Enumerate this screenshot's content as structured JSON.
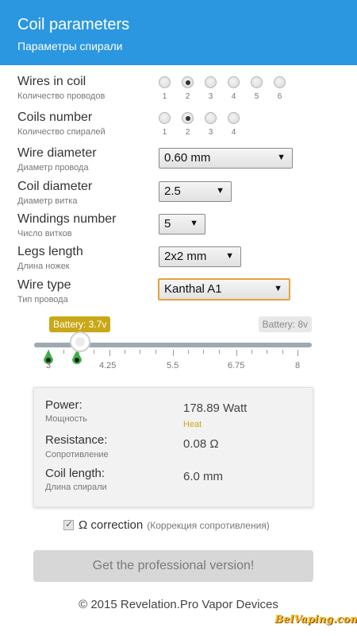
{
  "header": {
    "title": "Coil parameters",
    "subtitle": "Параметры спирали"
  },
  "params": {
    "wires": {
      "label": "Wires in coil",
      "sub": "Количество проводов",
      "options": [
        {
          "num": "1",
          "selected": false
        },
        {
          "num": "2",
          "selected": true
        },
        {
          "num": "3",
          "selected": false
        },
        {
          "num": "4",
          "selected": false
        },
        {
          "num": "5",
          "selected": false
        },
        {
          "num": "6",
          "selected": false
        }
      ]
    },
    "coils": {
      "label": "Coils number",
      "sub": "Количество спиралей",
      "options": [
        {
          "num": "1",
          "selected": false
        },
        {
          "num": "2",
          "selected": true
        },
        {
          "num": "3",
          "selected": false
        },
        {
          "num": "4",
          "selected": false
        }
      ]
    },
    "wire_diameter": {
      "label": "Wire diameter",
      "sub": "Диаметр провода",
      "value": "0.60 mm"
    },
    "coil_diameter": {
      "label": "Coil diameter",
      "sub": "Диаметр витка",
      "value": "2.5"
    },
    "windings": {
      "label": "Windings number",
      "sub": "Число витков",
      "value": "5"
    },
    "legs": {
      "label": "Legs length",
      "sub": "Длина ножек",
      "value": "2x2 mm"
    },
    "wire_type": {
      "label": "Wire type",
      "sub": "Тип провода",
      "value": "Kanthal A1"
    }
  },
  "battery": {
    "current_label": "Battery: 3.7v",
    "max_label": "Battery: 8v",
    "min": 3,
    "max": 8,
    "value": 3.7,
    "ticks": [
      "3",
      "4.25",
      "5.5",
      "6.75",
      "8"
    ]
  },
  "results": {
    "power": {
      "label": "Power:",
      "sub": "Мощность",
      "value": "178.89 Watt",
      "note": "Heat"
    },
    "resistance": {
      "label": "Resistance:",
      "sub": "Сопротивление",
      "value": "0.08 Ω"
    },
    "coil_length": {
      "label": "Coil length:",
      "sub": "Длина спирали",
      "value": "6.0 mm"
    }
  },
  "correction": {
    "label": "Ω correction",
    "sub": "(Коррекция сопротивления)",
    "checked": true
  },
  "pro_button": "Get the professional version!",
  "footer": "© 2015 Revelation.Pro Vapor Devices",
  "watermark": "BelVaping.com",
  "colors": {
    "header": "#2b97e0",
    "accent": "#c9a818",
    "select_focus": "#e5a33a"
  },
  "icons": {
    "arrow": "▼",
    "check": "✓"
  }
}
